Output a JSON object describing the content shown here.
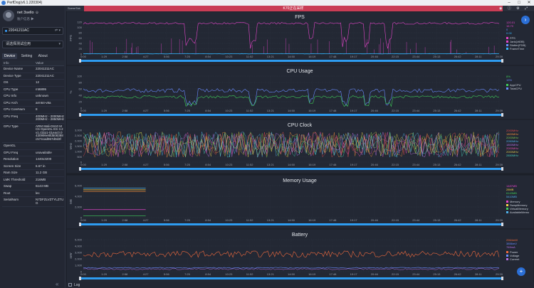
{
  "window": {
    "title": "PerfDog(v6.1.220304)",
    "minimize": "–",
    "maximize": "□",
    "close": "✕"
  },
  "user": {
    "name": "net 3sello ☺",
    "account": "账户信息 ▶"
  },
  "device_select": {
    "value": "22041211AC",
    "icons": "⇌ ▾"
  },
  "app_select": {
    "value": "请选择测试应用",
    "arrow": "▾"
  },
  "tabs": [
    "Device",
    "Setting",
    "About"
  ],
  "info": {
    "header": {
      "key": "Info",
      "value": "Value"
    },
    "rows": [
      {
        "k": "Device Name",
        "v": "22041211AC"
      },
      {
        "k": "Device Type",
        "v": "22041211AC"
      },
      {
        "k": "OS",
        "v": "12"
      },
      {
        "k": "CPU Type",
        "v": "mt6895"
      },
      {
        "k": "CPU Info",
        "v": "unknown"
      },
      {
        "k": "CPU Arch",
        "v": "arm64-v8a"
      },
      {
        "k": "CPU CoreNum",
        "v": "8"
      },
      {
        "k": "CPU Freq",
        "v": "400MHz - 2000MHz 200MHz - 2850MHz"
      },
      {
        "k": "GPU Type",
        "v": "ARM Mali-G610 MC6 OpenGL ES 3.2 v1.r32p1-01eac0.0 43099ee8fd508388c574cad967d0d3f"
      },
      {
        "k": "OpenGL",
        "v": ""
      },
      {
        "k": "GPU Freq",
        "v": "unavailable"
      },
      {
        "k": "Resolution",
        "v": "1440x3200"
      },
      {
        "k": "Screen Size",
        "v": "6.67 in"
      },
      {
        "k": "Ram Size",
        "v": "11.2 GB"
      },
      {
        "k": "LMK Threshold",
        "v": "216MB"
      },
      {
        "k": "Swap",
        "v": "6143 MB"
      },
      {
        "k": "Root",
        "v": "lec"
      },
      {
        "k": "SerialNum",
        "v": "N7DFZLVZTYLZTUG"
      }
    ]
  },
  "topbar": {
    "scene_tab": "SceneTab",
    "banner": "K70正在采样",
    "icons": "◉ ⓘ ⚙ ⤢"
  },
  "bottombar": {
    "log": "Log"
  },
  "time_ticks": [
    "0:00",
    "1:29",
    "2:58",
    "4:27",
    "5:56",
    "7:25",
    "8:54",
    "10:23",
    "11:52",
    "13:21",
    "14:50",
    "16:19",
    "17:48",
    "19:17",
    "20:46",
    "22:15",
    "23:44",
    "25:13",
    "26:42",
    "28:11",
    "29:39"
  ],
  "charts": [
    {
      "title": "FPS",
      "y_label": "FPS",
      "y_ticks": [
        "120",
        "100",
        "80",
        "60",
        "40",
        "20",
        "0"
      ],
      "legend_values": [
        {
          "text": "120.01",
          "color": "#e246c9"
        },
        {
          "text": "16.70",
          "color": "#e246c9"
        },
        {
          "text": "0",
          "color": "#6a8cff"
        },
        {
          "text": "0.00",
          "color": "#35b7ff"
        }
      ],
      "legend_names": [
        {
          "text": "FPS",
          "color": "#e246c9"
        },
        {
          "text": "Jank(≥60B)",
          "color": "#e246c9"
        },
        {
          "text": "Stutter(FDB)",
          "color": "#6a8cff"
        },
        {
          "text": "FrameTime",
          "color": "#35b7ff"
        }
      ]
    },
    {
      "title": "CPU Usage",
      "y_label": "%",
      "y_ticks": [
        "100",
        "80",
        "60",
        "40",
        "20",
        "0"
      ],
      "legend_values": [
        {
          "text": "8%",
          "color": "#3fce5a"
        },
        {
          "text": "19%",
          "color": "#6a8cff"
        }
      ],
      "legend_names": [
        {
          "text": "AppCPU",
          "color": "#3fce5a"
        },
        {
          "text": "TotalCPU",
          "color": "#6a8cff"
        }
      ]
    },
    {
      "title": "CPU Clock",
      "y_label": "MHz",
      "y_ticks": [
        "3,000",
        "2,500",
        "2,000",
        "1,500",
        "1,000",
        "500",
        "0"
      ],
      "legend_values": [
        {
          "text": "2000MHz",
          "color": "#e24a4a"
        },
        {
          "text": "1800MHz",
          "color": "#f08c3a"
        },
        {
          "text": "2000MHz",
          "color": "#7cc14d"
        },
        {
          "text": "2050MHz",
          "color": "#4fb0e8"
        },
        {
          "text": "1800MHz",
          "color": "#b56ee0"
        },
        {
          "text": "2000MHz",
          "color": "#e04fa8"
        },
        {
          "text": "2000MHz",
          "color": "#d6c14a"
        },
        {
          "text": "2850MHz",
          "color": "#47c9b5"
        }
      ],
      "legend_names": []
    },
    {
      "title": "Memory Usage",
      "y_label": "MB",
      "y_ticks": [
        "6,000",
        "4,000",
        "2,000",
        "0"
      ],
      "legend_values": [
        {
          "text": "1487MB",
          "color": "#e246c9"
        },
        {
          "text": "28MB",
          "color": "#f5d04a"
        },
        {
          "text": "6143MB",
          "color": "#3fce5a"
        },
        {
          "text": "5410MB",
          "color": "#4fb0e8"
        }
      ],
      "legend_names": [
        {
          "text": "Memory",
          "color": "#e246c9"
        },
        {
          "text": "SwapMemory",
          "color": "#f5d04a"
        },
        {
          "text": "VirtualMemory",
          "color": "#3fce5a"
        },
        {
          "text": "AvailableMemo",
          "color": "#4fb0e8"
        }
      ]
    },
    {
      "title": "Battery",
      "y_label": "mW",
      "y_ticks": [
        "5,000",
        "4,000",
        "3,000",
        "2,000",
        "1,000",
        "0"
      ],
      "legend_values": [
        {
          "text": "2964mW",
          "color": "#ef6a3e"
        },
        {
          "text": "3856mV",
          "color": "#6a8cff"
        },
        {
          "text": "769mA",
          "color": "#b56ee0"
        }
      ],
      "legend_names": [
        {
          "text": "Power",
          "color": "#ef6a3e"
        },
        {
          "text": "Voltage",
          "color": "#6a8cff"
        },
        {
          "text": "Current",
          "color": "#b56ee0"
        }
      ]
    }
  ]
}
